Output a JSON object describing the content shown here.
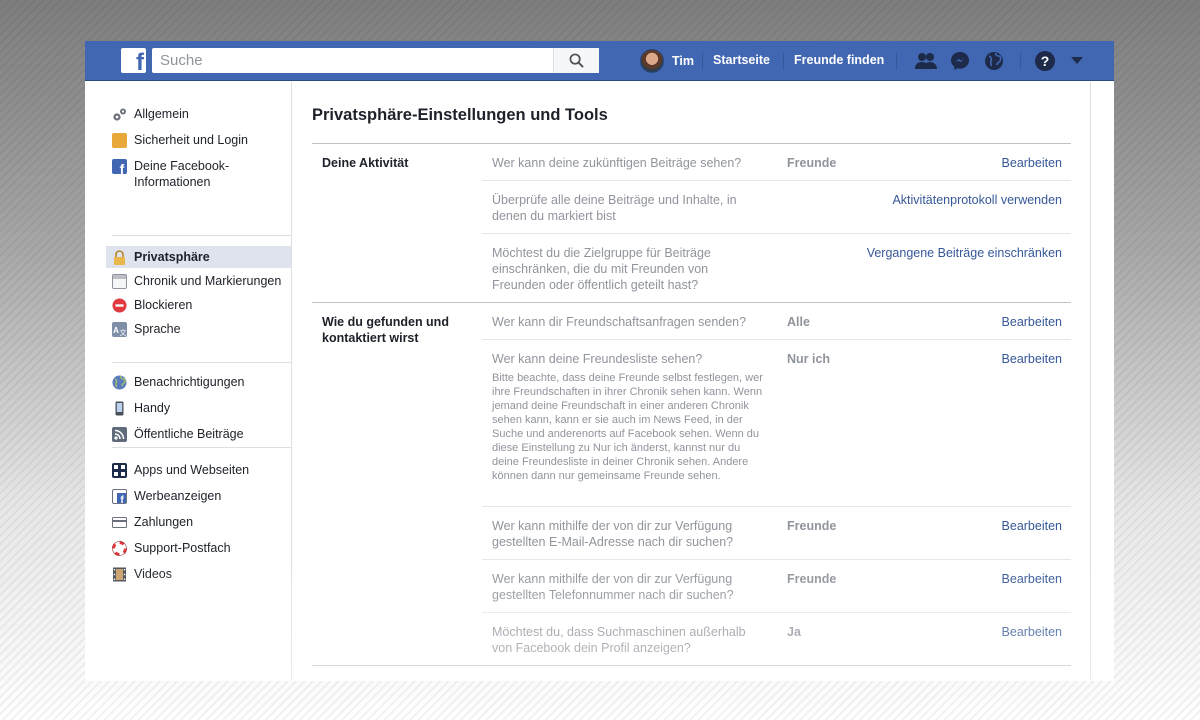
{
  "topbar": {
    "logo_letter": "f",
    "search_placeholder": "Suche",
    "user_name": "Tim",
    "nav_home": "Startseite",
    "nav_find_friends": "Freunde finden",
    "accent": "#4267b2"
  },
  "sidebar": {
    "groups": [
      [
        {
          "label": "Allgemein",
          "icon": "gears-icon"
        },
        {
          "label": "Sicherheit und Login",
          "icon": "shield-icon"
        },
        {
          "label": "Deine Facebook-Informationen",
          "icon": "facebook-icon"
        }
      ],
      [
        {
          "label": "Privatsphäre",
          "icon": "lock-icon",
          "active": true
        },
        {
          "label": "Chronik und Markierungen",
          "icon": "timeline-icon"
        },
        {
          "label": "Blockieren",
          "icon": "block-icon"
        },
        {
          "label": "Sprache",
          "icon": "language-icon"
        }
      ],
      [
        {
          "label": "Benachrichtigungen",
          "icon": "globe-icon"
        },
        {
          "label": "Handy",
          "icon": "phone-icon"
        },
        {
          "label": "Öffentliche Beiträge",
          "icon": "rss-icon"
        }
      ],
      [
        {
          "label": "Apps und Webseiten",
          "icon": "apps-icon"
        },
        {
          "label": "Werbeanzeigen",
          "icon": "ads-icon"
        },
        {
          "label": "Zahlungen",
          "icon": "card-icon"
        },
        {
          "label": "Support-Postfach",
          "icon": "lifebuoy-icon"
        },
        {
          "label": "Videos",
          "icon": "film-icon"
        }
      ]
    ]
  },
  "main": {
    "title": "Privatsphäre-Einstellungen und Tools",
    "sections": [
      {
        "title": "Deine Aktivität",
        "rows": [
          {
            "question": "Wer kann deine zukünftigen Beiträge sehen?",
            "value": "Freunde",
            "action": "Bearbeiten"
          },
          {
            "question": "Überprüfe alle deine Beiträge und Inhalte, in denen du markiert bist",
            "value": "",
            "action": "Aktivitätenprotokoll verwenden"
          },
          {
            "question": "Möchtest du die Zielgruppe für Beiträge einschränken, die du mit Freunden von Freunden oder öffentlich geteilt hast?",
            "value": "",
            "action": "Vergangene Beiträge einschränken"
          }
        ]
      },
      {
        "title": "Wie du gefunden und kontaktiert wirst",
        "rows": [
          {
            "question": "Wer kann dir Freundschaftsanfragen senden?",
            "value": "Alle",
            "action": "Bearbeiten"
          },
          {
            "question": "Wer kann deine Freundesliste sehen?",
            "note": "Bitte beachte, dass deine Freunde selbst festlegen, wer ihre Freundschaften in ihrer Chronik sehen kann. Wenn jemand deine Freundschaft in einer anderen Chronik sehen kann, kann er sie auch im News Feed, in der Suche und anderenorts auf Facebook sehen. Wenn du diese Einstellung zu Nur ich änderst, kannst nur du deine Freundesliste in deiner Chronik sehen. Andere können dann nur gemeinsame Freunde sehen.",
            "value": "Nur ich",
            "action": "Bearbeiten"
          },
          {
            "question": "Wer kann mithilfe der von dir zur Verfügung gestellten E-Mail-Adresse nach dir suchen?",
            "value": "Freunde",
            "action": "Bearbeiten"
          },
          {
            "question": "Wer kann mithilfe der von dir zur Verfügung gestellten Telefonnummer nach dir suchen?",
            "value": "Freunde",
            "action": "Bearbeiten"
          },
          {
            "question": "Möchtest du, dass Suchmaschinen außerhalb von Facebook dein Profil anzeigen?",
            "value": "Ja",
            "action": "Bearbeiten"
          }
        ]
      }
    ]
  }
}
